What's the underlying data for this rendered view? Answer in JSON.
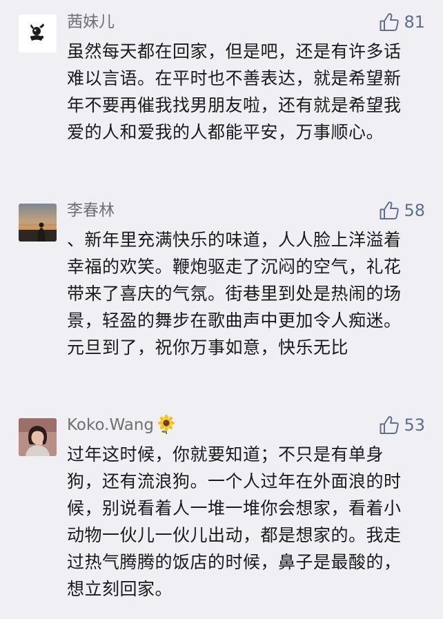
{
  "comments": [
    {
      "username": "茜妹儿",
      "likes": "81",
      "text": "虽然每天都在回家，但是吧，还是有许多话难以言语。在平时也不善表达，就是希望新年不要再催我找男朋友啦，还有就是希望我爱的人和爱我的人都能平安，万事顺心。"
    },
    {
      "username": "李春林",
      "likes": "58",
      "text": "、新年里充满快乐的味道，人人脸上洋溢着幸福的欢笑。鞭炮驱走了沉闷的空气，礼花带来了喜庆的气氛。街巷里到处是热闹的场景，轻盈的舞步在歌曲声中更加令人痴迷。元旦到了，祝你万事如意，快乐无比"
    },
    {
      "username": "Koko.Wang",
      "username_emoji": "sunflower-icon",
      "likes": "53",
      "text": "过年这时候，你就要知道；不只是有单身狗，还有流浪狗。一个人过年在外面浪的时候，别说看着人一堆一堆你会想家，看着小动物一伙儿一伙儿出动，都是想家的。我走过热气腾腾的饭店的时候，鼻子是最酸的，想立刻回家。"
    }
  ],
  "colors": {
    "background": "#efeff4",
    "username": "#707070",
    "like_accent": "#5d6e8e",
    "text": "#1a1a1a"
  }
}
